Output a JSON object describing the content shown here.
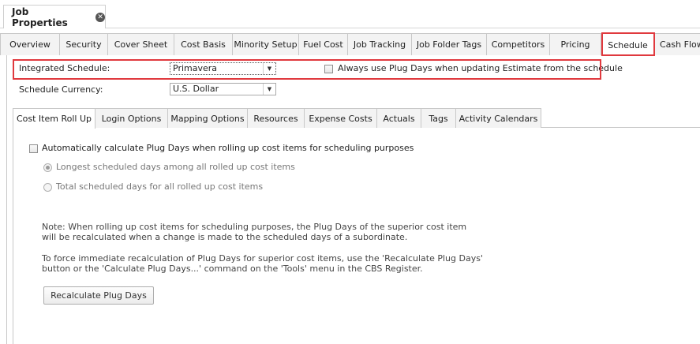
{
  "document_tab": {
    "title": "Job Properties",
    "close_symbol": "✕"
  },
  "main_tabs": [
    {
      "label": "Overview"
    },
    {
      "label": "Security"
    },
    {
      "label": "Cover Sheet"
    },
    {
      "label": "Cost Basis"
    },
    {
      "label": "Minority Setup"
    },
    {
      "label": "Fuel Cost"
    },
    {
      "label": "Job Tracking"
    },
    {
      "label": "Job Folder Tags"
    },
    {
      "label": "Competitors"
    },
    {
      "label": "Pricing"
    },
    {
      "label": "Schedule",
      "active": true
    },
    {
      "label": "Cash Flow"
    }
  ],
  "schedule": {
    "integrated_label": "Integrated Schedule:",
    "integrated_value": "Primavera",
    "always_plug_label": "Always use Plug Days when updating Estimate from the schedule",
    "always_plug_checked": false,
    "currency_label": "Schedule Currency:",
    "currency_value": "U.S. Dollar"
  },
  "sub_tabs": [
    {
      "label": "Cost Item Roll Up",
      "active": true
    },
    {
      "label": "Login Options"
    },
    {
      "label": "Mapping Options"
    },
    {
      "label": "Resources"
    },
    {
      "label": "Expense Costs"
    },
    {
      "label": "Actuals"
    },
    {
      "label": "Tags"
    },
    {
      "label": "Activity Calendars"
    }
  ],
  "rollup": {
    "auto_calc_label": "Automatically calculate Plug Days when rolling up cost items for scheduling purposes",
    "auto_calc_checked": false,
    "option_longest": "Longest scheduled days among all rolled up cost items",
    "option_total": "Total scheduled days for all rolled up cost items",
    "selected_option": "longest",
    "note_line1": "Note:  When rolling up cost items for scheduling purposes, the Plug Days of the superior cost item",
    "note_line2": "will be recalculated when a change is made to the scheduled days of a subordinate.",
    "force_line1": "To force immediate recalculation of Plug Days for superior cost items, use the 'Recalculate Plug Days'",
    "force_line2": "button or the 'Calculate Plug Days...' command on the 'Tools' menu in the CBS Register.",
    "recalc_button": "Recalculate Plug Days"
  },
  "colors": {
    "highlight": "#e0393e"
  }
}
